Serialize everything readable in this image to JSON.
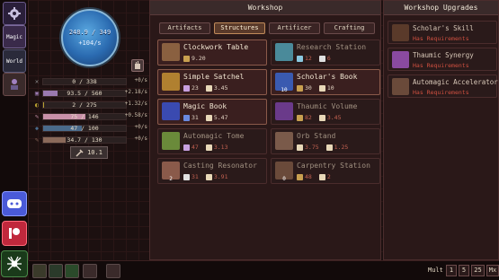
{
  "sidebar": {
    "magic_label": "Magic",
    "world_label": "World"
  },
  "orb": {
    "value": "248.9 / 349",
    "rate": "+104/s",
    "fill_fraction": 0.71
  },
  "resources": [
    {
      "name": "gold",
      "text": "0 / 338",
      "rate": "+0/s",
      "fill": 0.0,
      "color": "#8a8a8a"
    },
    {
      "name": "research",
      "text": "93.5 / 560",
      "rate": "+2.18/s",
      "fill": 0.17,
      "color": "#9a7ab0"
    },
    {
      "name": "lore",
      "text": "2 / 275",
      "rate": "+1.32/s",
      "fill": 0.01,
      "color": "#b8a030"
    },
    {
      "name": "runes",
      "text": "75 / 146",
      "rate": "+0.58/s",
      "fill": 0.51,
      "color": "#c890a8"
    },
    {
      "name": "water",
      "text": "47 / 100",
      "rate": "+0/s",
      "fill": 0.47,
      "color": "#4a6a8a"
    },
    {
      "name": "wood",
      "text": "34.7 / 130",
      "rate": "+0/s",
      "fill": 0.27,
      "color": "#8a6a5a"
    }
  ],
  "multiplier_box": "10.1",
  "workshop": {
    "title": "Workshop",
    "tabs": [
      "Artifacts",
      "Structures",
      "Artificer",
      "Crafting"
    ],
    "active_tab": "Structures"
  },
  "cards": [
    {
      "name": "Clockwork Table",
      "count": "",
      "costs": [
        {
          "icon": "wand",
          "v": "9.20"
        }
      ],
      "state": "afford",
      "col": 0,
      "row": 0,
      "icon_color": "#8a6040"
    },
    {
      "name": "Research Station",
      "count": "",
      "costs": [
        {
          "icon": "flask",
          "v": "12"
        },
        {
          "icon": "cross",
          "v": "6"
        }
      ],
      "state": "dim",
      "col": 1,
      "row": 0,
      "icon_color": "#4a8a9a"
    },
    {
      "name": "Simple Satchel",
      "count": "",
      "costs": [
        {
          "icon": "gem",
          "v": "23"
        },
        {
          "icon": "scroll",
          "v": "3.45"
        }
      ],
      "state": "afford",
      "col": 0,
      "row": 1,
      "icon_color": "#b08030"
    },
    {
      "name": "Scholar's Book",
      "count": "10",
      "costs": [
        {
          "icon": "wand",
          "v": "30"
        },
        {
          "icon": "scroll",
          "v": "10"
        }
      ],
      "state": "afford",
      "col": 1,
      "row": 1,
      "icon_color": "#3a5ab0"
    },
    {
      "name": "Magic Book",
      "count": "",
      "costs": [
        {
          "icon": "book",
          "v": "31"
        },
        {
          "icon": "scroll",
          "v": "5.47"
        }
      ],
      "state": "afford",
      "col": 0,
      "row": 2,
      "icon_color": "#3a4ab0"
    },
    {
      "name": "Thaumic Volume",
      "count": "",
      "costs": [
        {
          "icon": "wand",
          "v": "82"
        },
        {
          "icon": "scroll",
          "v": "3.45"
        }
      ],
      "state": "dim",
      "col": 1,
      "row": 2,
      "icon_color": "#6a3a8a"
    },
    {
      "name": "Automagic Tome",
      "count": "",
      "costs": [
        {
          "icon": "gem",
          "v": "47"
        },
        {
          "icon": "scroll",
          "v": "3.13"
        }
      ],
      "state": "dim",
      "col": 0,
      "row": 3,
      "icon_color": "#6a8a3a"
    },
    {
      "name": "Orb Stand",
      "count": "",
      "costs": [
        {
          "icon": "scroll",
          "v": "3.75"
        },
        {
          "icon": "scroll",
          "v": "1.25"
        }
      ],
      "state": "dim",
      "col": 1,
      "row": 3,
      "icon_color": "#7a5a4a"
    },
    {
      "name": "Casting Resonator",
      "count": "2",
      "costs": [
        {
          "icon": "cross",
          "v": "31"
        },
        {
          "icon": "scroll",
          "v": "3.91"
        }
      ],
      "state": "dim",
      "col": 0,
      "row": 4,
      "icon_color": "#8a5a4a"
    },
    {
      "name": "Carpentry Station",
      "count": "0",
      "costs": [
        {
          "icon": "wand",
          "v": "48"
        },
        {
          "icon": "scroll",
          "v": "2"
        }
      ],
      "state": "dim",
      "col": 1,
      "row": 4,
      "icon_color": "#6a4a3a"
    }
  ],
  "upgrades": {
    "title": "Workshop Upgrades",
    "items": [
      {
        "name": "Scholar's Skill",
        "req": "Has Requirements",
        "icon_color": "#5a3a2a"
      },
      {
        "name": "Thaumic Synergy",
        "req": "Has Requirements",
        "icon_color": "#8a4aa0"
      },
      {
        "name": "Automagic Accelerator",
        "req": "Has Requirements",
        "icon_color": "#6a4a3a"
      }
    ]
  },
  "bottom": {
    "mult_label": "Mult",
    "mult_options": [
      "1",
      "5",
      "25",
      "Mx"
    ]
  },
  "colors": {
    "accent": "#c08a5a",
    "danger": "#d05040",
    "panel": "#2a1818"
  }
}
